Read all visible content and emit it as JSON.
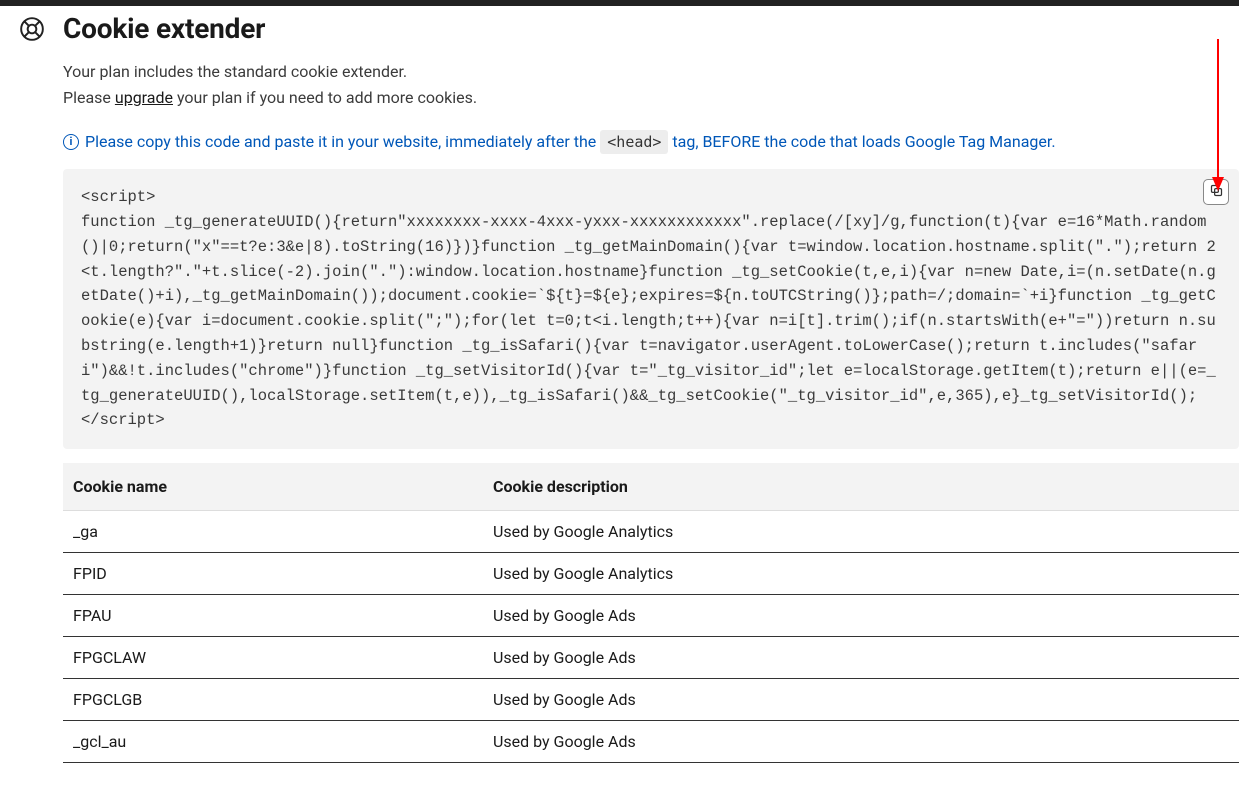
{
  "page": {
    "title": "Cookie extender",
    "subtitle_line1": "Your plan includes the standard cookie extender.",
    "subtitle_line2_pre": "Please ",
    "subtitle_upgrade": "upgrade",
    "subtitle_line2_post": " your plan if you need to add more cookies."
  },
  "notice": {
    "text_pre": "Please copy this code and paste it in your website, immediately after the ",
    "head_tag": "<head>",
    "text_post": " tag, BEFORE the code that loads Google Tag Manager."
  },
  "code_snippet": "<script>\nfunction _tg_generateUUID(){return\"xxxxxxxx-xxxx-4xxx-yxxx-xxxxxxxxxxxx\".replace(/[xy]/g,function(t){var e=16*Math.random()|0;return(\"x\"==t?e:3&e|8).toString(16)})}function _tg_getMainDomain(){var t=window.location.hostname.split(\".\");return 2<t.length?\".\"+t.slice(-2).join(\".\"):window.location.hostname}function _tg_setCookie(t,e,i){var n=new Date,i=(n.setDate(n.getDate()+i),_tg_getMainDomain());document.cookie=`${t}=${e};expires=${n.toUTCString()};path=/;domain=`+i}function _tg_getCookie(e){var i=document.cookie.split(\";\");for(let t=0;t<i.length;t++){var n=i[t].trim();if(n.startsWith(e+\"=\"))return n.substring(e.length+1)}return null}function _tg_isSafari(){var t=navigator.userAgent.toLowerCase();return t.includes(\"safari\")&&!t.includes(\"chrome\")}function _tg_setVisitorId(){var t=\"_tg_visitor_id\";let e=localStorage.getItem(t);return e||(e=_tg_generateUUID(),localStorage.setItem(t,e)),_tg_isSafari()&&_tg_setCookie(\"_tg_visitor_id\",e,365),e}_tg_setVisitorId();\n</script>",
  "table": {
    "headers": {
      "name": "Cookie name",
      "desc": "Cookie description"
    },
    "rows": [
      {
        "name": "_ga",
        "desc": "Used by Google Analytics"
      },
      {
        "name": "FPID",
        "desc": "Used by Google Analytics"
      },
      {
        "name": "FPAU",
        "desc": "Used by Google Ads"
      },
      {
        "name": "FPGCLAW",
        "desc": "Used by Google Ads"
      },
      {
        "name": "FPGCLGB",
        "desc": "Used by Google Ads"
      },
      {
        "name": "_gcl_au",
        "desc": "Used by Google Ads"
      }
    ]
  },
  "icons": {
    "help": "help-icon",
    "info": "info-icon",
    "copy": "copy-icon"
  }
}
